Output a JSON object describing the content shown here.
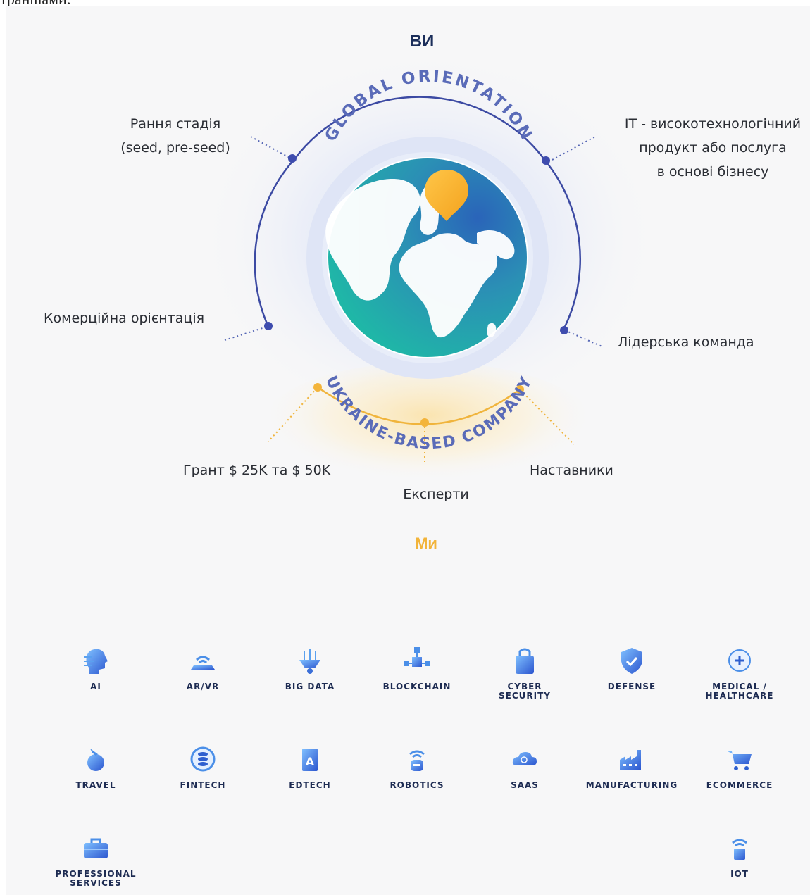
{
  "top_text": "траншами.",
  "diagram": {
    "you_title": "ВИ",
    "we_title": "Ми",
    "ring_top_text": "GLOBAL ORIENTATION",
    "ring_bottom_text": "UKRAINE-BASED COMPANY",
    "criteria": [
      {
        "id": "early",
        "text": "Рання стадія\n(seed, pre-seed)"
      },
      {
        "id": "it",
        "text": "IT - високотехнологічний\nпродукт або послуга\nв основі бізнесу"
      },
      {
        "id": "commercial",
        "text": "Комерційна орієнтація"
      },
      {
        "id": "leader",
        "text": "Лідерська команда"
      }
    ],
    "offers": [
      {
        "id": "grant",
        "text": "Грант $ 25K та $ 50K"
      },
      {
        "id": "experts",
        "text": "Експерти"
      },
      {
        "id": "mentors",
        "text": "Наставники"
      }
    ],
    "colors": {
      "navy": "#2f3c8f",
      "orange": "#f2b433",
      "title_navy": "#1b2e5a",
      "title_orange": "#f2b43a"
    }
  },
  "industries": [
    {
      "label": "AI",
      "icon": "ai-head-icon"
    },
    {
      "label": "AR/VR",
      "icon": "ar-vr-icon"
    },
    {
      "label": "BIG DATA",
      "icon": "big-data-icon"
    },
    {
      "label": "BLOCKCHAIN",
      "icon": "blockchain-icon"
    },
    {
      "label": "CYBER\nSECURITY",
      "icon": "lock-icon"
    },
    {
      "label": "DEFENSE",
      "icon": "shield-icon"
    },
    {
      "label": "MEDICAL /\nHEALTHCARE",
      "icon": "medical-plus-icon"
    },
    {
      "label": "TRAVEL",
      "icon": "travel-icon"
    },
    {
      "label": "FINTECH",
      "icon": "coins-icon"
    },
    {
      "label": "EDTECH",
      "icon": "edtech-book-icon"
    },
    {
      "label": "ROBOTICS",
      "icon": "robot-icon"
    },
    {
      "label": "SAAS",
      "icon": "cloud-icon"
    },
    {
      "label": "MANUFACTURING",
      "icon": "factory-icon"
    },
    {
      "label": "ECOMMERCE",
      "icon": "cart-icon"
    },
    {
      "label": "PROFESSIONAL\nSERVICES",
      "icon": "briefcase-icon"
    },
    {
      "label": "IOT",
      "icon": "iot-icon"
    }
  ]
}
